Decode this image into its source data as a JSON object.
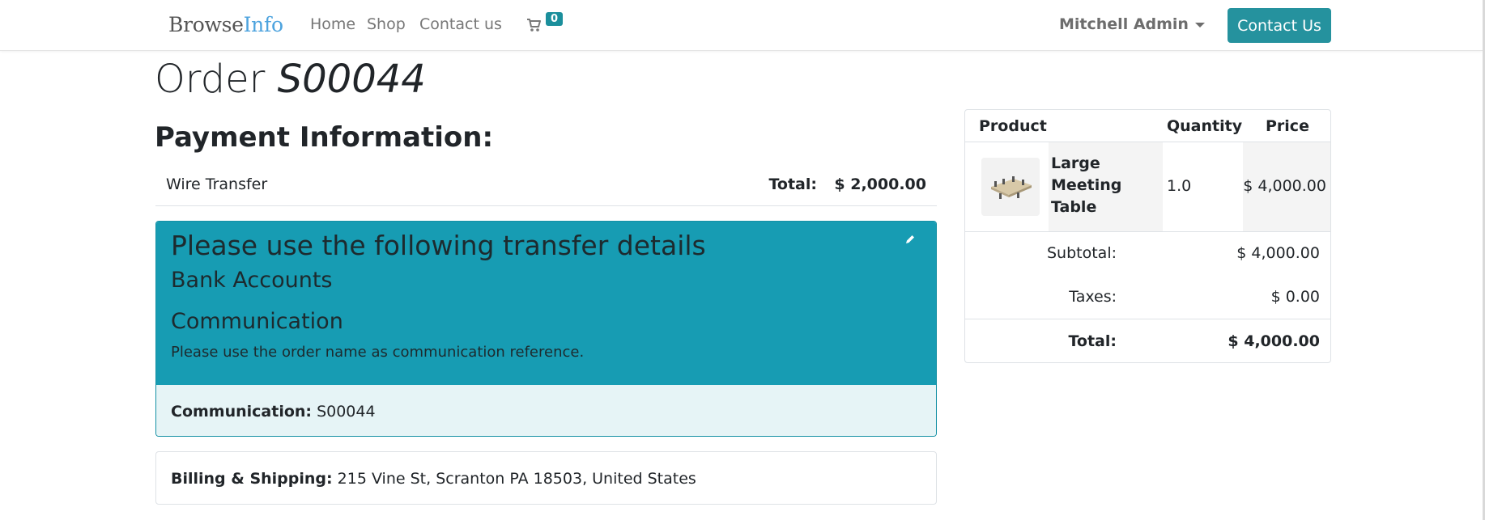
{
  "brand": {
    "part1": "Browse",
    "part2": "Info"
  },
  "nav": {
    "home": "Home",
    "shop": "Shop",
    "contact": "Contact us"
  },
  "cart": {
    "count": "0"
  },
  "user": {
    "name": "Mitchell Admin"
  },
  "cta": {
    "label": "Contact Us"
  },
  "order": {
    "label": "Order",
    "number": "S00044"
  },
  "payment": {
    "heading": "Payment Information:",
    "method": "Wire Transfer",
    "total_label": "Total:",
    "total_value": "$ 2,000.00"
  },
  "transfer": {
    "title": "Please use the following transfer details",
    "bank_accounts": "Bank Accounts",
    "communication_heading": "Communication",
    "note": "Please use the order name as communication reference.",
    "communication_label": "Communication:",
    "communication_value": "S00044"
  },
  "billing": {
    "label": "Billing & Shipping:",
    "address": "215 Vine St, Scranton PA 18503, United States"
  },
  "summary": {
    "headers": {
      "product": "Product",
      "quantity": "Quantity",
      "price": "Price"
    },
    "line": {
      "name": "Large Meeting Table",
      "quantity": "1.0",
      "price": "$ 4,000.00"
    },
    "subtotal_label": "Subtotal:",
    "subtotal_value": "$ 4,000.00",
    "taxes_label": "Taxes:",
    "taxes_value": "$ 0.00",
    "total_label": "Total:",
    "total_value": "$ 4,000.00"
  },
  "colors": {
    "accent": "#25929e",
    "info": "#179cb3",
    "info_light": "#e6f4f6",
    "brand_blue": "#4da3de",
    "corner": "#71506a"
  },
  "icons": {
    "cart": "shopping-cart-icon",
    "edit": "pencil-icon",
    "editor": "editor-toggle-icon"
  }
}
